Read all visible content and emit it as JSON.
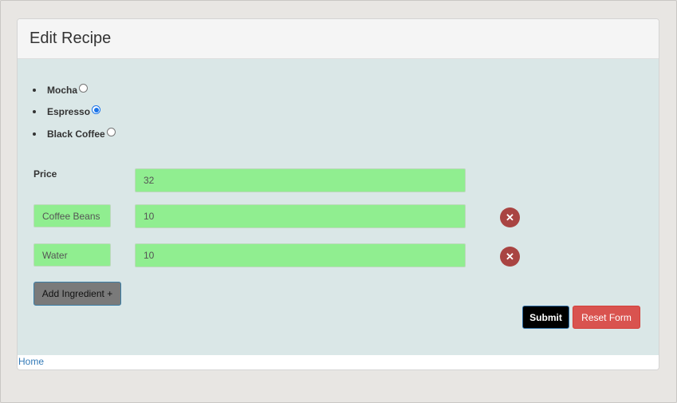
{
  "header": {
    "title": "Edit Recipe"
  },
  "drinks": [
    {
      "label": "Mocha",
      "selected": false
    },
    {
      "label": "Espresso",
      "selected": true
    },
    {
      "label": "Black Coffee",
      "selected": false
    }
  ],
  "price": {
    "label": "Price",
    "value": "32"
  },
  "ingredients": [
    {
      "name": "Coffee Beans",
      "amount": "10",
      "remove_glyph": "✕"
    },
    {
      "name": "Water",
      "amount": "10",
      "remove_glyph": "✕"
    }
  ],
  "buttons": {
    "add_ingredient": "Add Ingredient +",
    "submit": "Submit",
    "reset": "Reset Form"
  },
  "footer": {
    "home_link": "Home"
  },
  "colors": {
    "input_bg": "#90ee90",
    "body_bg": "#dae7e7",
    "remove_btn": "#a94442",
    "reset_btn": "#d9534f",
    "submit_btn": "#000000",
    "radio_accent": "#1a73e8"
  }
}
